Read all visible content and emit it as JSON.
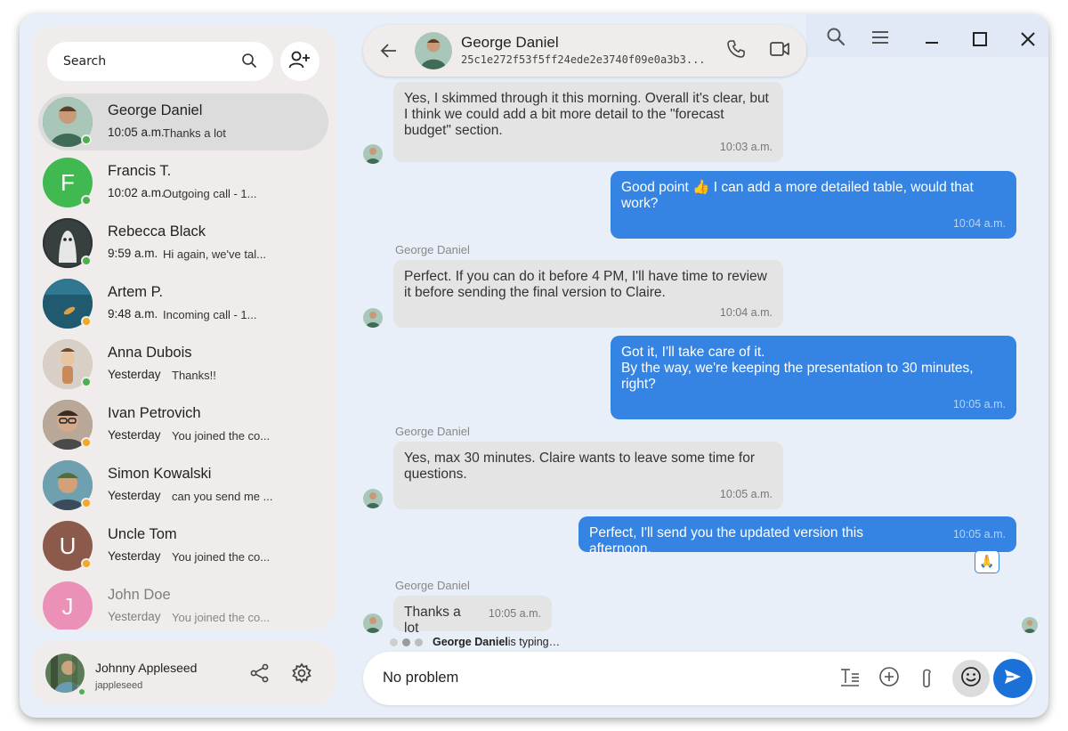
{
  "sidebar": {
    "search_placeholder": "Search",
    "contacts": [
      {
        "name": "George Daniel",
        "time": "10:05 a.m.",
        "preview": "Thanks a lot",
        "status": "online",
        "avatar": "photo",
        "avatar_color": "#4a7a6a"
      },
      {
        "name": "Francis T.",
        "time": "10:02 a.m.",
        "preview": "Outgoing call - 1...",
        "status": "online",
        "avatar": "initial",
        "initial": "F",
        "avatar_color": "#3fb950"
      },
      {
        "name": "Rebecca Black",
        "time": "9:59 a.m.",
        "preview": "Hi again, we've tal...",
        "status": "online",
        "avatar": "photo",
        "avatar_color": "#2d3338"
      },
      {
        "name": "Artem P.",
        "time": "9:48 a.m.",
        "preview": "Incoming call - 1...",
        "status": "away",
        "avatar": "photo",
        "avatar_color": "#1f5a6e"
      },
      {
        "name": "Anna Dubois",
        "time": "Yesterday",
        "preview": "Thanks!!",
        "status": "online",
        "avatar": "photo",
        "avatar_color": "#c8b9a8"
      },
      {
        "name": "Ivan Petrovich",
        "time": "Yesterday",
        "preview": "You joined the co...",
        "status": "away",
        "avatar": "photo",
        "avatar_color": "#8a6a55"
      },
      {
        "name": "Simon Kowalski",
        "time": "Yesterday",
        "preview": "can you send me ...",
        "status": "away",
        "avatar": "photo",
        "avatar_color": "#5a8a9a"
      },
      {
        "name": "Uncle Tom",
        "time": "Yesterday",
        "preview": "You joined the co...",
        "status": "away",
        "avatar": "initial",
        "initial": "U",
        "avatar_color": "#8b5a4a"
      },
      {
        "name": "John Doe",
        "time": "Yesterday",
        "preview": "You joined the co...",
        "status": "none",
        "avatar": "initial",
        "initial": "J",
        "avatar_color": "#e8468a"
      }
    ]
  },
  "account": {
    "name": "Johnny Appleseed",
    "handle": "jappleseed"
  },
  "chat": {
    "contact_name": "George Daniel",
    "contact_id": "25c1e272f53f5ff24ede2e3740f09e0a3b3...",
    "messages": [
      {
        "dir": "in",
        "sender": "",
        "text": "Yes, I skimmed through it this morning. Overall it's clear, but I think we could add a bit more detail to the \"forecast budget\" section.",
        "time": "10:03 a.m."
      },
      {
        "dir": "out",
        "text": "Good point 👍 I can add a more detailed table, would that work?",
        "time": "10:04 a.m."
      },
      {
        "dir": "in",
        "sender": "George Daniel",
        "text": "Perfect. If you can do it before 4 PM, I'll have time to review it before sending the final version to Claire.",
        "time": "10:04 a.m."
      },
      {
        "dir": "out",
        "text": "Got it, I'll take care of it.\nBy the way, we're keeping the presentation to 30 minutes, right?",
        "time": "10:05 a.m."
      },
      {
        "dir": "in",
        "sender": "George Daniel",
        "text": "Yes, max 30 minutes. Claire wants to leave some time for questions.",
        "time": "10:05 a.m."
      },
      {
        "dir": "out",
        "text": "Perfect, I'll send you the updated version this afternoon.",
        "time": "10:05 a.m.",
        "reaction": "🙏"
      },
      {
        "dir": "in",
        "sender": "George Daniel",
        "text": "Thanks a lot",
        "time": "10:05 a.m."
      }
    ],
    "typing_name": "George Daniel",
    "typing_suffix": " is typing…"
  },
  "composer": {
    "draft": "No problem"
  },
  "colors": {
    "accent": "#3584e4",
    "send": "#1c71d8",
    "online": "#4caf50",
    "away": "#f5a623"
  }
}
